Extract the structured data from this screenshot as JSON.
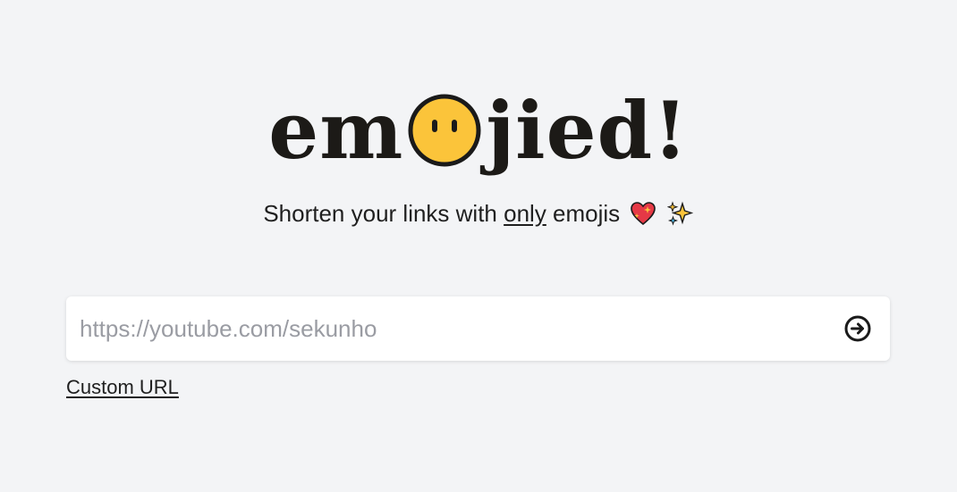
{
  "logo": {
    "left_text": "em",
    "right_text": "jied!",
    "face_icon": "no-mouth-face-icon"
  },
  "tagline": {
    "before": "Shorten your links with ",
    "emphasis": "only",
    "after": " emojis",
    "emojis": [
      "sparkling-heart-icon",
      "sparkles-icon"
    ]
  },
  "search": {
    "placeholder": "https://youtube.com/sekunho",
    "value": "",
    "submit_icon": "arrow-right-circle-icon"
  },
  "custom_url": {
    "label": "Custom URL"
  },
  "colors": {
    "background": "#f3f4f6",
    "face_yellow": "#fbc43a",
    "heart_red": "#e53946",
    "sparkle_yellow": "#fbc43a"
  }
}
